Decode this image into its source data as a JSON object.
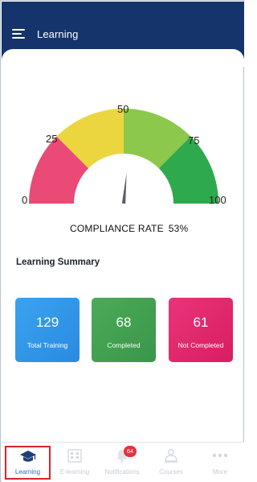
{
  "header": {
    "title": "Learning",
    "background_color": "#14346b",
    "menu_icon": "hamburger-menu-icon"
  },
  "gauge": {
    "ticks": [
      "0",
      "25",
      "50",
      "75",
      "100"
    ],
    "value_percent": 53,
    "segment_colors": [
      "#e94b76",
      "#ecd63f",
      "#8cc84b",
      "#2ea94d"
    ],
    "caption_label": "COMPLIANCE RATE",
    "caption_value": "53%"
  },
  "summary": {
    "title": "Learning Summary",
    "cards": [
      {
        "value": "129",
        "label": "Total Training",
        "color": "#2e94e6"
      },
      {
        "value": "68",
        "label": "Completed",
        "color": "#43a052"
      },
      {
        "value": "61",
        "label": "Not Completed",
        "color": "#e02a6c"
      }
    ]
  },
  "bottom_nav": {
    "items": [
      {
        "label": "Learning",
        "icon": "graduation-cap-icon",
        "active": true
      },
      {
        "label": "E-learning",
        "icon": "building-icon",
        "active": false
      },
      {
        "label": "Notifications",
        "icon": "bell-icon",
        "active": false,
        "badge": "64"
      },
      {
        "label": "Courses",
        "icon": "presenter-icon",
        "active": false
      },
      {
        "label": "More",
        "icon": "more-dots-icon",
        "active": false
      }
    ]
  }
}
